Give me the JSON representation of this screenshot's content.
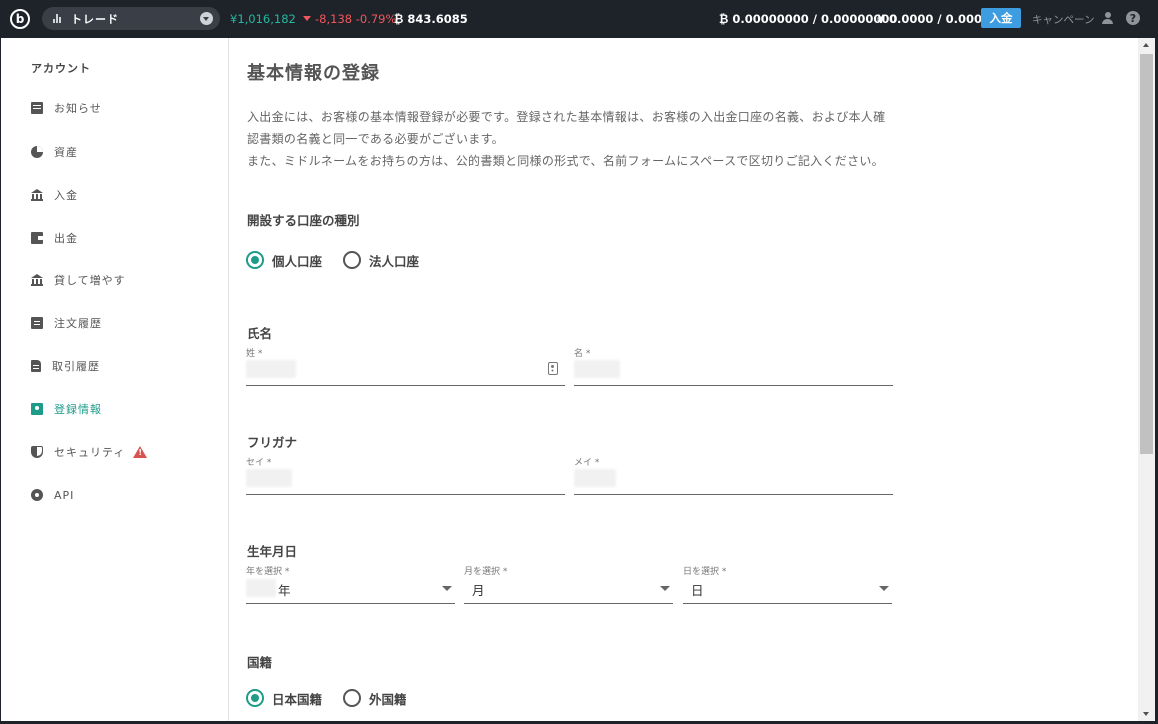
{
  "topbar": {
    "logo_text": "b",
    "mode_label": "トレード",
    "jpy_total": "¥1,016,182",
    "change": "-8,138 -0.79%",
    "btc_price": "₿ 843.6085",
    "btc_balance": "₿ 0.00000000 / 0.00000000",
    "jpy_balance": "¥ 0.0000 / 0.0000",
    "deposit_label": "入金",
    "campaign_label": "キャンペーン",
    "help_label": "?",
    "colors": {
      "bar": "#1e2329",
      "positive": "#25b8a0",
      "negative": "#f0565c",
      "button": "#3d9de0"
    }
  },
  "sidebar": {
    "title": "アカウント",
    "items": [
      {
        "label": "お知らせ",
        "icon": "message-icon"
      },
      {
        "label": "資産",
        "icon": "pie-chart-icon"
      },
      {
        "label": "入金",
        "icon": "bank-icon"
      },
      {
        "label": "出金",
        "icon": "wallet-icon"
      },
      {
        "label": "貸して増やす",
        "icon": "bank-icon"
      },
      {
        "label": "注文履歴",
        "icon": "clipboard-icon"
      },
      {
        "label": "取引履歴",
        "icon": "document-icon"
      },
      {
        "label": "登録情報",
        "icon": "badge-icon",
        "active": true
      },
      {
        "label": "セキュリティ",
        "icon": "shield-icon",
        "warning": true
      },
      {
        "label": "API",
        "icon": "gear-icon"
      }
    ],
    "active_color": "#1f9b8a",
    "warning_color": "#d9534f"
  },
  "main": {
    "title": "基本情報の登録",
    "description": [
      "入出金には、お客様の基本情報登録が必要です。登録された基本情報は、お客様の入出金口座の名義、および本人確",
      "認書類の名義と同一である必要がございます。",
      "また、ミドルネームをお持ちの方は、公的書類と同様の形式で、名前フォームにスペースで区切りご記入ください。"
    ],
    "account_type": {
      "heading": "開設する口座の種別",
      "options": [
        {
          "label": "個人口座",
          "checked": true
        },
        {
          "label": "法人口座",
          "checked": false
        }
      ]
    },
    "name": {
      "heading": "氏名",
      "last_label": "姓 *",
      "first_label": "名 *"
    },
    "furigana": {
      "heading": "フリガナ",
      "last_label": "セイ *",
      "first_label": "メイ *"
    },
    "birthdate": {
      "heading": "生年月日",
      "year_label": "年を選択 *",
      "year_value": "年",
      "month_label": "月を選択 *",
      "month_value": "月",
      "day_label": "日を選択 *",
      "day_value": "日"
    },
    "nationality": {
      "heading": "国籍",
      "options": [
        {
          "label": "日本国籍",
          "checked": true
        },
        {
          "label": "外国籍",
          "checked": false
        }
      ]
    }
  }
}
